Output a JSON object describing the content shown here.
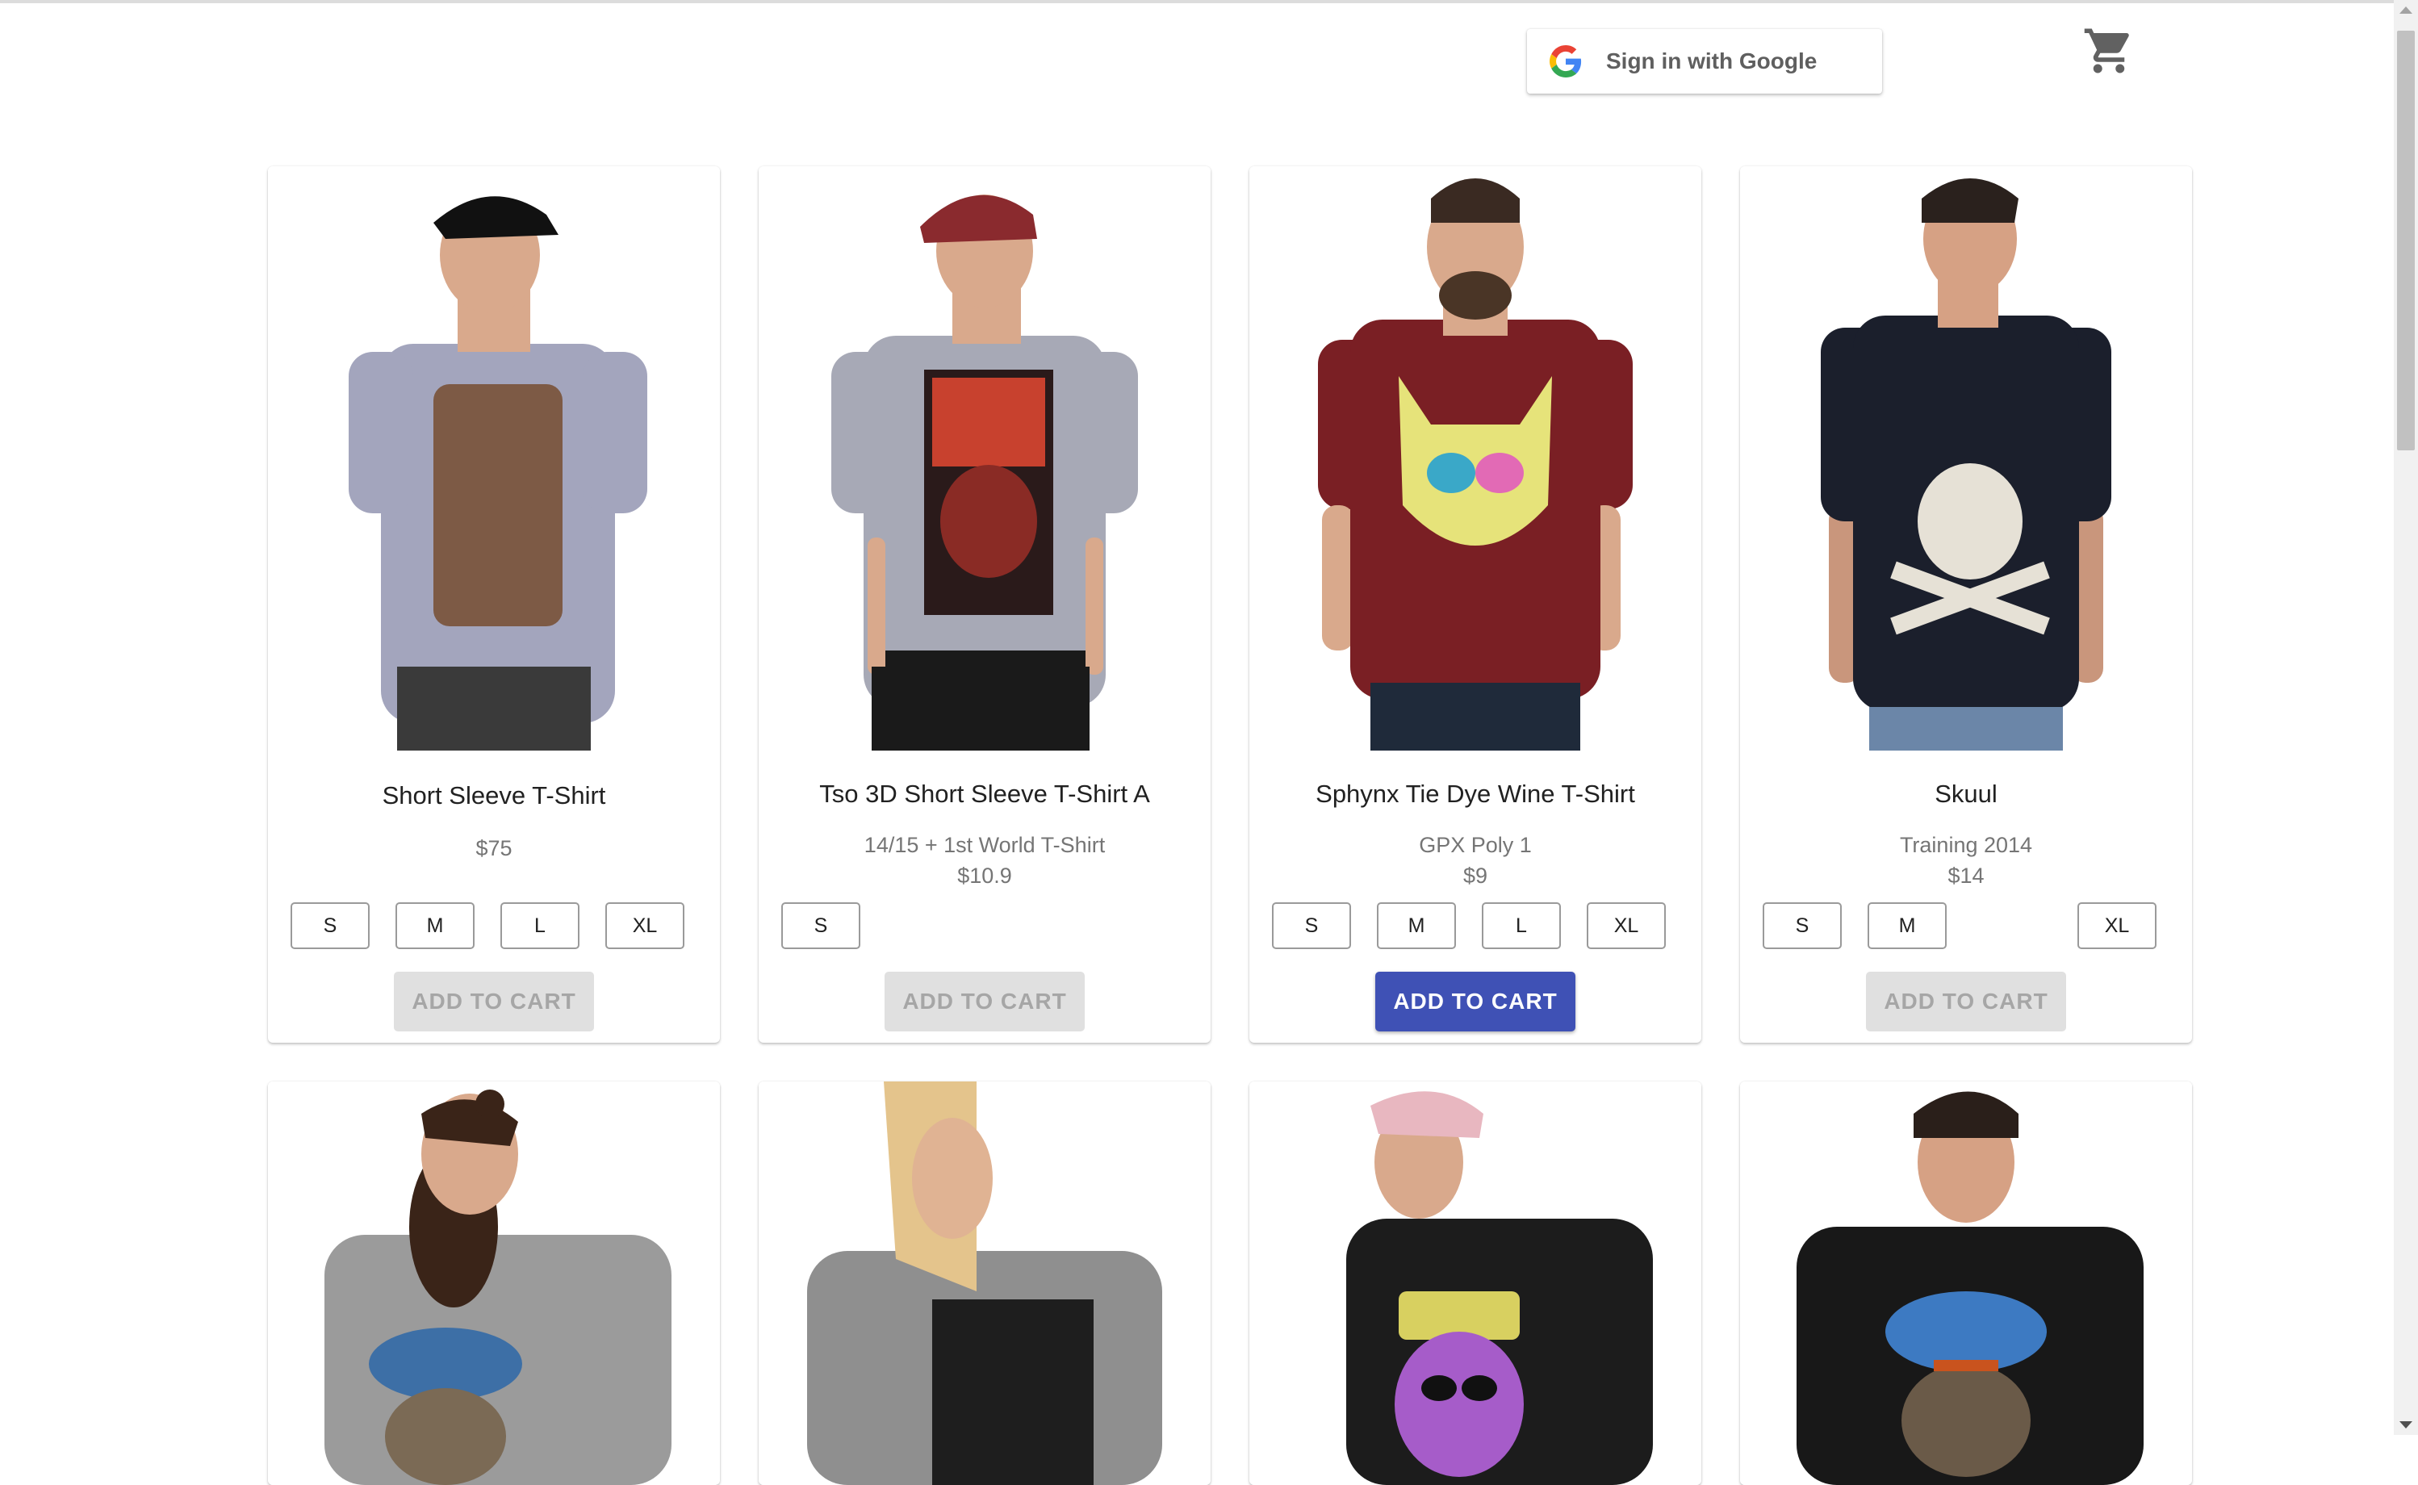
{
  "header": {
    "signin_label": "Sign in with Google",
    "cart_icon": "shopping-cart-icon",
    "google_icon": "google-g-icon"
  },
  "colors": {
    "primary": "#3f51b5",
    "disabled_bg": "#e0e0e0",
    "disabled_text": "#a6a6a6"
  },
  "products": [
    {
      "name": "Short Sleeve T-Shirt",
      "style": "",
      "price": "$75",
      "sizes": [
        "S",
        "M",
        "L",
        "XL"
      ],
      "add_label": "ADD TO CART",
      "add_enabled": false,
      "shirt_color": "#a3a5bd",
      "print": "blunt-figure"
    },
    {
      "name": "Tso 3D Short Sleeve T-Shirt A",
      "style": "14/15 + 1st World T-Shirt",
      "price": "$10.9",
      "sizes": [
        "S"
      ],
      "add_label": "ADD TO CART",
      "add_enabled": false,
      "shirt_color": "#a7a9b6",
      "print": "tiger-skull"
    },
    {
      "name": "Sphynx Tie Dye Wine T-Shirt",
      "style": "GPX Poly 1",
      "price": "$9",
      "sizes": [
        "S",
        "M",
        "L",
        "XL"
      ],
      "add_label": "ADD TO CART",
      "add_enabled": true,
      "shirt_color": "#7a1f24",
      "print": "tie-dye-cat"
    },
    {
      "name": "Skuul",
      "style": "Training 2014",
      "price": "$14",
      "sizes": [
        "S",
        "M",
        "XL"
      ],
      "add_label": "ADD TO CART",
      "add_enabled": false,
      "shirt_color": "#1b1f2c",
      "print": "blunt-skull"
    },
    {
      "name": "",
      "shirt_color": "#9b9b9b",
      "print": "blunt-monkey"
    },
    {
      "name": "",
      "shirt_color": "#8f8f8f",
      "print": "freak-text"
    },
    {
      "name": "",
      "shirt_color": "#1c1c1c",
      "print": "purple-creature"
    },
    {
      "name": "",
      "shirt_color": "#181818",
      "print": "blunt-monkey"
    }
  ]
}
